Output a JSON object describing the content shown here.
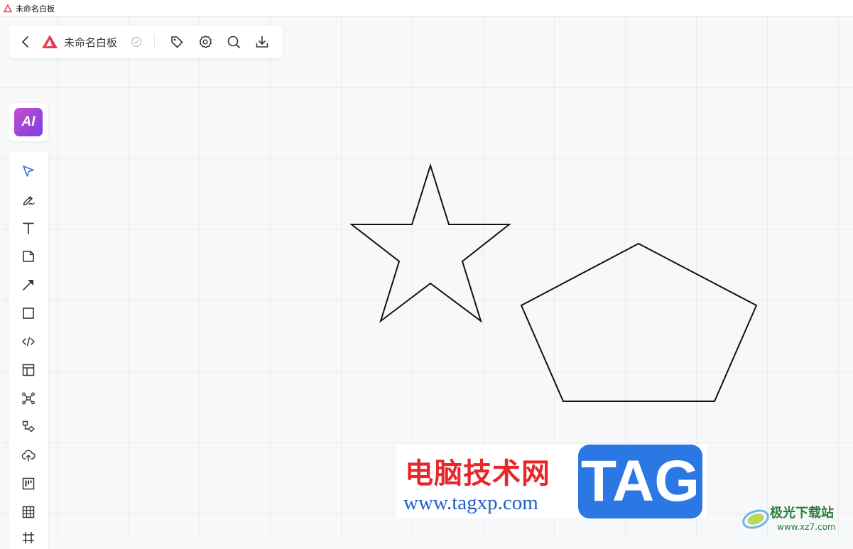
{
  "window": {
    "title": "未命名白板",
    "logo_color": "#e8425a"
  },
  "toolbar": {
    "back_icon": "chevron-left-icon",
    "board_title": "未命名白板",
    "saved_icon": "check-circle-icon",
    "actions": [
      {
        "name": "tag",
        "icon": "tag-icon"
      },
      {
        "name": "settings",
        "icon": "gear-icon"
      },
      {
        "name": "search",
        "icon": "search-icon"
      },
      {
        "name": "download",
        "icon": "download-icon"
      }
    ]
  },
  "ai": {
    "label": "AI",
    "color_from": "#c14fd0",
    "color_to": "#7b3fe4"
  },
  "tools": [
    {
      "name": "select",
      "icon": "cursor-arrow-icon",
      "active": true
    },
    {
      "name": "pen",
      "icon": "pen-icon"
    },
    {
      "name": "text",
      "icon": "text-icon"
    },
    {
      "name": "sticky-note",
      "icon": "sticky-note-icon"
    },
    {
      "name": "arrow",
      "icon": "arrow-icon"
    },
    {
      "name": "shape",
      "icon": "rectangle-icon"
    },
    {
      "name": "code",
      "icon": "code-icon"
    },
    {
      "name": "layout",
      "icon": "layout-icon"
    },
    {
      "name": "mindmap",
      "icon": "mindmap-icon"
    },
    {
      "name": "flowchart",
      "icon": "flowchart-icon"
    },
    {
      "name": "upload",
      "icon": "cloud-upload-icon"
    },
    {
      "name": "kanban",
      "icon": "kanban-icon"
    },
    {
      "name": "table",
      "icon": "table-icon"
    },
    {
      "name": "frame",
      "icon": "frame-icon"
    }
  ],
  "canvas": {
    "shapes": [
      "star",
      "pentagon"
    ],
    "stroke": "#111111"
  },
  "watermark": {
    "cn": "电脑技术网",
    "url": "www.tagxp.com",
    "tag": "TAG",
    "site2_cn": "极光下载站",
    "site2_url": "www.xz7.com"
  }
}
